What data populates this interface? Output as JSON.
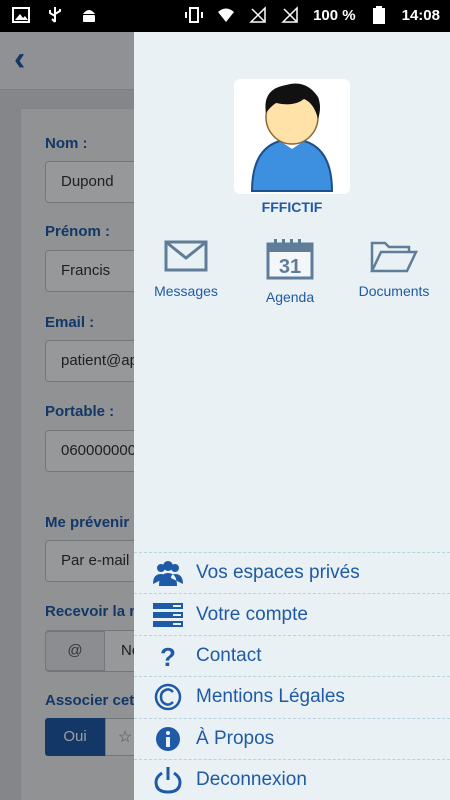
{
  "status_bar": {
    "battery": "100 %",
    "time": "14:08"
  },
  "form": {
    "nom_label": "Nom :",
    "nom_value": "Dupond",
    "prenom_label": "Prénom :",
    "prenom_value": "Francis",
    "email_label": "Email :",
    "email_value": "patient@ap",
    "portable_label": "Portable :",
    "portable_value": "060000000",
    "prevenir_label": "Me prévenir c",
    "prevenir_value": "Par e-mail",
    "recevoir_label": "Recevoir la m",
    "recevoir_addon": "@",
    "recevoir_value": "No",
    "associer_label": "Associer cet",
    "associer_yes": "Oui",
    "associer_star": "☆"
  },
  "drawer": {
    "user_name": "FFFICTIF",
    "quick_links": [
      {
        "label": "Messages",
        "icon": "envelope-icon"
      },
      {
        "label": "Agenda",
        "icon": "calendar-icon",
        "day": "31"
      },
      {
        "label": "Documents",
        "icon": "folder-icon"
      }
    ],
    "menu": [
      {
        "label": "Vos espaces privés",
        "icon": "users-icon"
      },
      {
        "label": "Votre compte",
        "icon": "account-list-icon"
      },
      {
        "label": "Contact",
        "icon": "question-icon"
      },
      {
        "label": "Mentions Légales",
        "icon": "copyright-icon"
      },
      {
        "label": "À Propos",
        "icon": "info-icon"
      },
      {
        "label": "Deconnexion",
        "icon": "power-icon"
      }
    ]
  },
  "colors": {
    "accent": "#1f5aa6",
    "drawer_bg": "#e9f1f4",
    "icon_gray": "#5f7d99"
  }
}
